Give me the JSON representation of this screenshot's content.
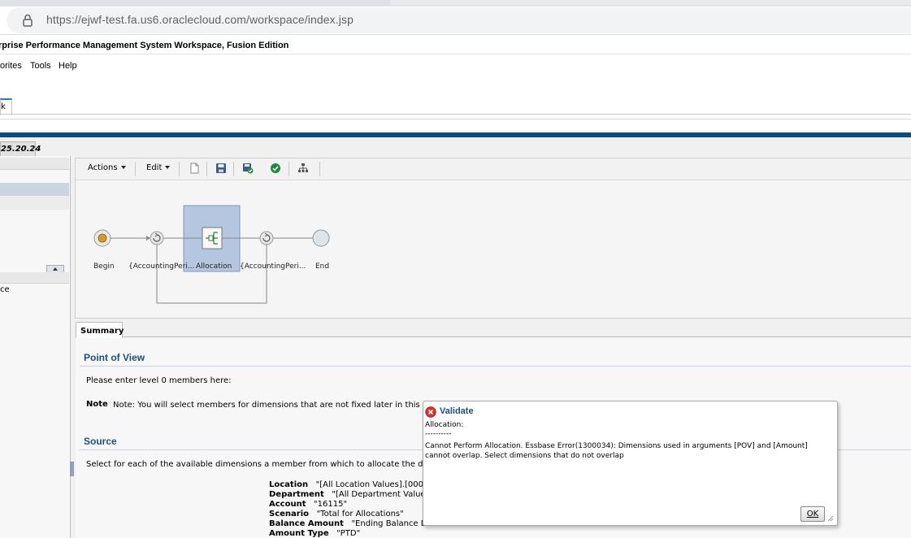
{
  "browser": {
    "url": "https://ejwf-test.fa.us6.oraclecloud.com/workspace/index.jsp"
  },
  "app": {
    "title": "rprise Performance Management System Workspace, Fusion Edition",
    "menu": {
      "favorites": "orites",
      "tools": "Tools",
      "help": "Help"
    },
    "doc_tab": "k",
    "version_tab": "25.20.24"
  },
  "left_panel": {
    "item": "ce"
  },
  "toolbar": {
    "actions": "Actions",
    "edit": "Edit"
  },
  "flow": {
    "nodes": [
      {
        "label": "Begin"
      },
      {
        "label": "{AccountingPeri..."
      },
      {
        "label": "Allocation"
      },
      {
        "label": "{AccountingPeri..."
      },
      {
        "label": "End"
      }
    ]
  },
  "summary": {
    "tab": "Summary",
    "pov_title": "Point of View",
    "pov_text": "Please enter level 0 members here:",
    "note_label": "Note",
    "note_text": "Note: You will select members for dimensions that are not fixed later in this wizard.",
    "source_title": "Source",
    "source_text": "Select for each of the available dimensions a member from which to allocate the data (*). You",
    "source_rows": [
      {
        "key": "Location",
        "value": "\"[All Location Values].[0000]\""
      },
      {
        "key": "Department",
        "value": "\"[All Department Values].[0"
      },
      {
        "key": "Account",
        "value": "\"16115\""
      },
      {
        "key": "Scenario",
        "value": "\"Total for Allocations\""
      },
      {
        "key": "Balance Amount",
        "value": "\"Ending Balance Dr\""
      },
      {
        "key": "Amount Type",
        "value": "\"PTD\""
      }
    ]
  },
  "dialog": {
    "title": "Validate",
    "line1": "Allocation:",
    "line2": "----------",
    "message": "Cannot Perform Allocation. Essbase Error(1300034): Dimensions used in arguments [POV] and [Amount] cannot overlap. Select dimensions that do not overlap",
    "ok": "OK"
  },
  "colors": {
    "accent_blue": "#0b4b85",
    "section_title": "#1f4e79",
    "error_red": "#d9322b"
  }
}
